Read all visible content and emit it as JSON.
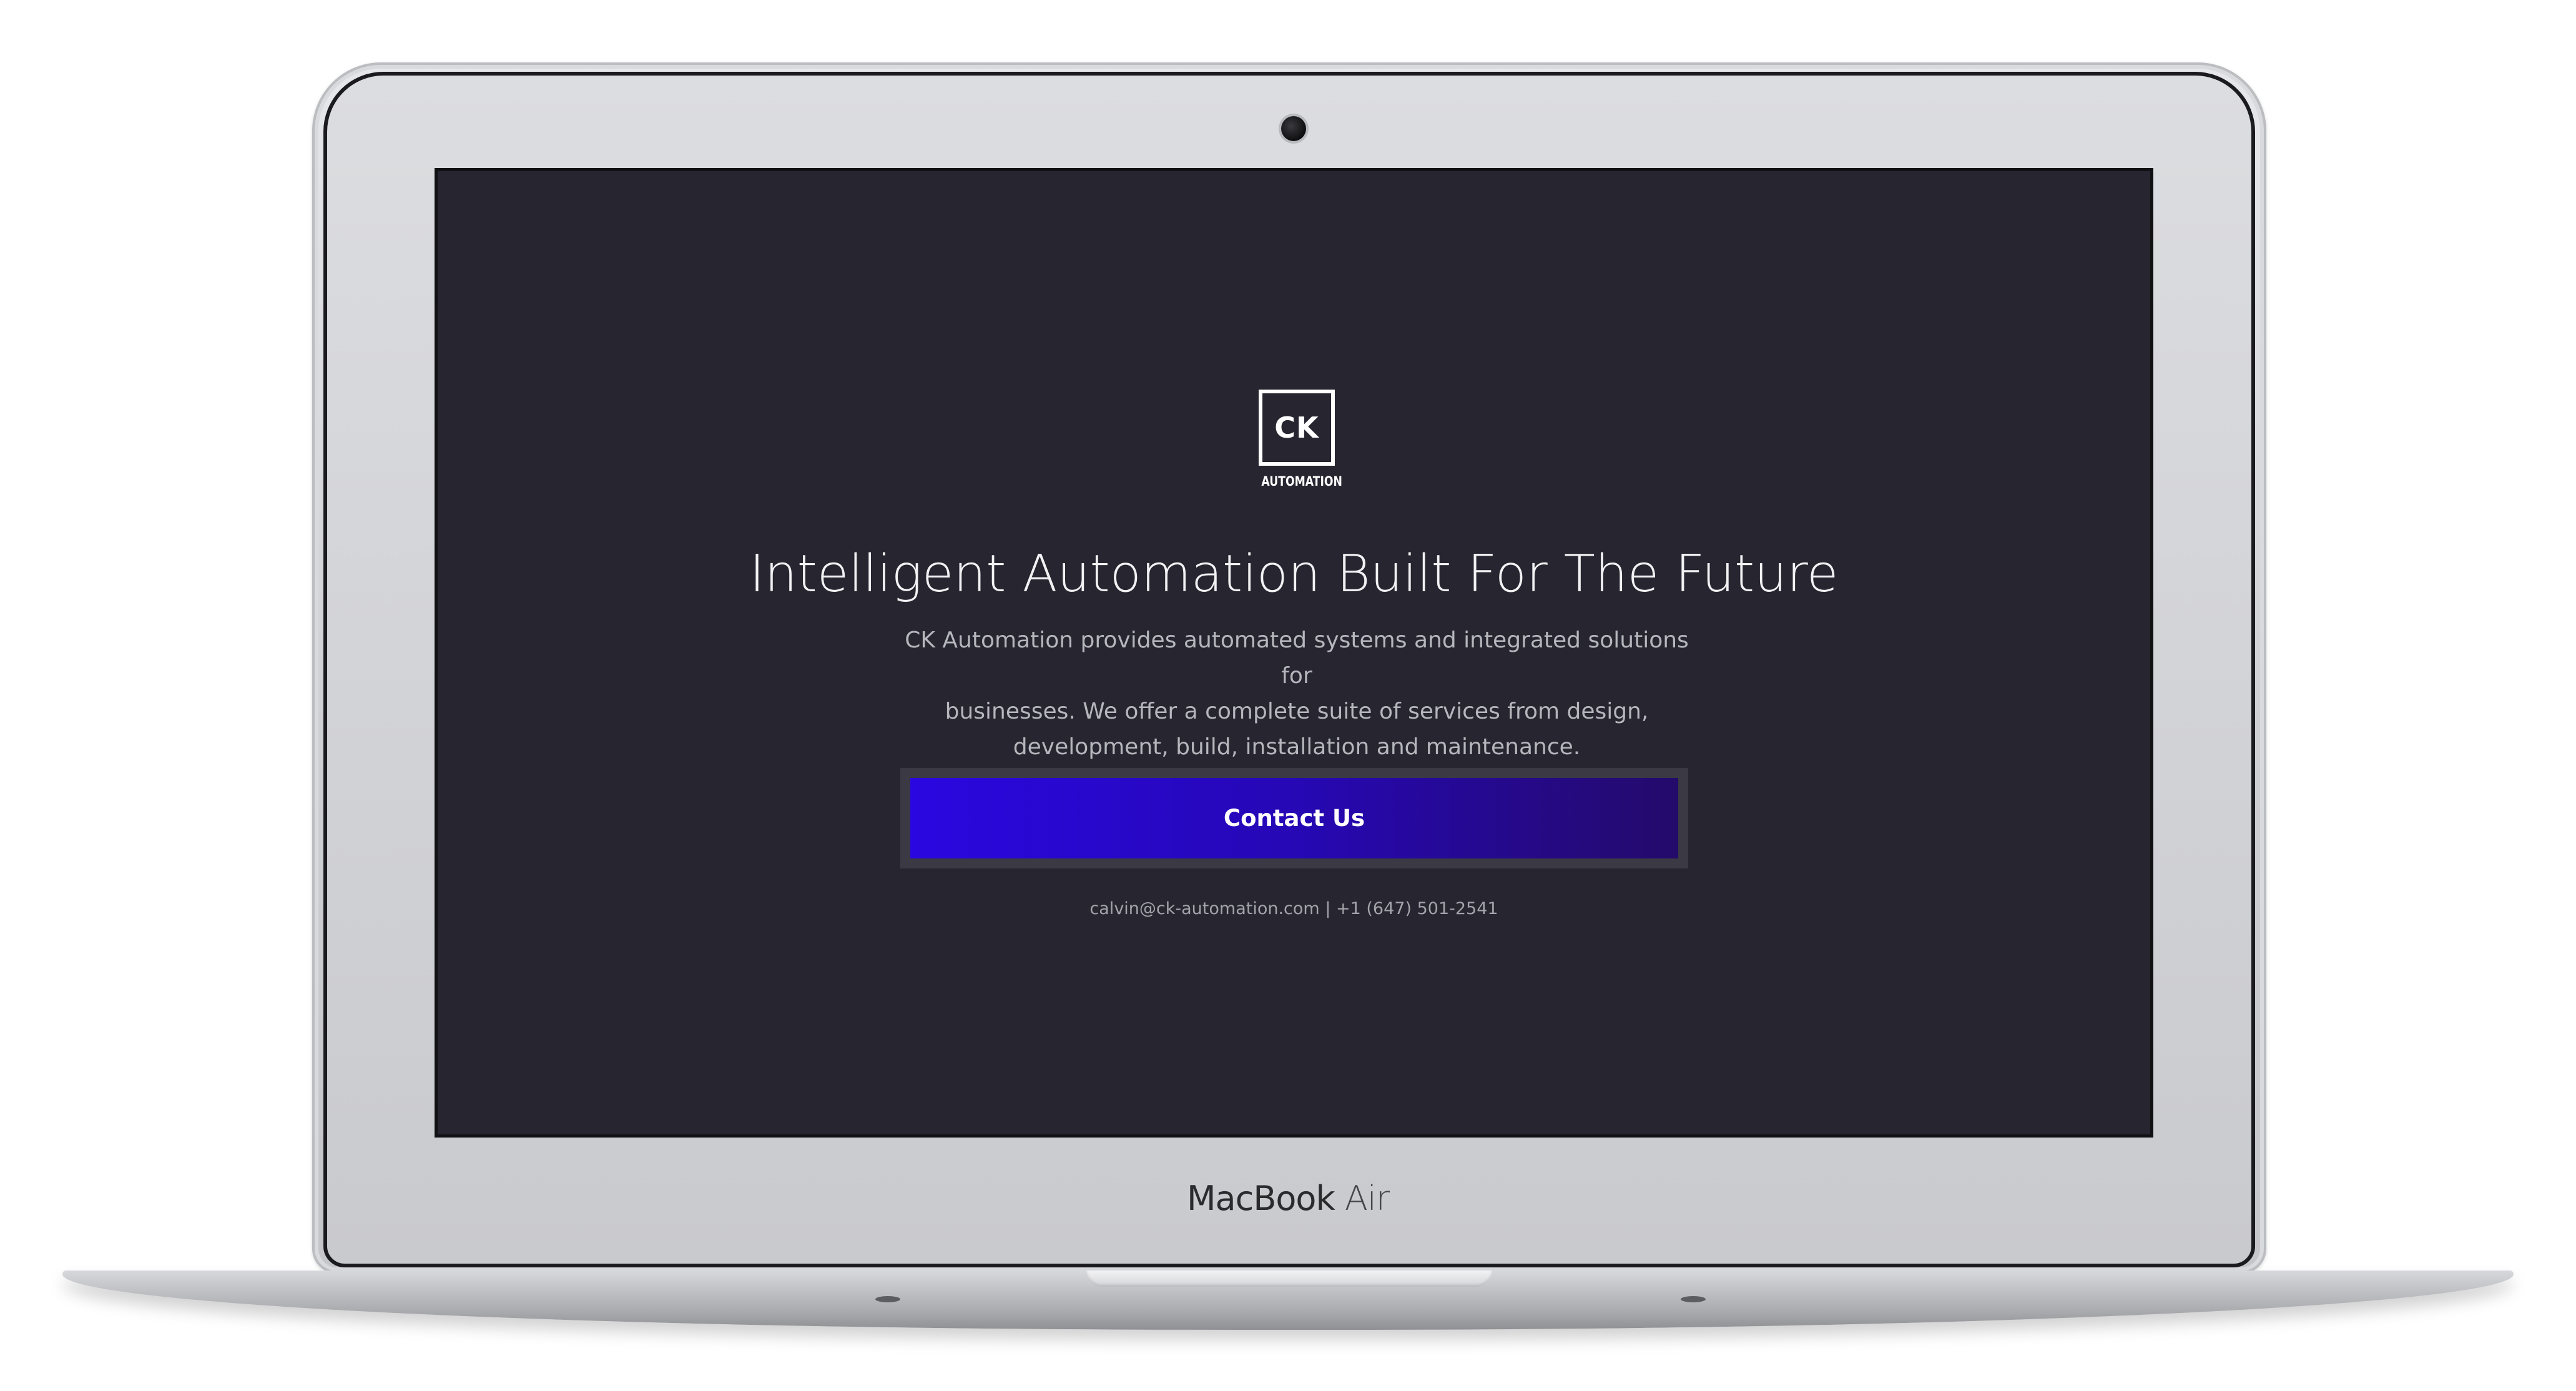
{
  "device": {
    "brand_label": "MacBook",
    "model_label": "Air"
  },
  "page": {
    "logo": {
      "initials": "CK",
      "subtitle": "AUTOMATION"
    },
    "headline": "Intelligent Automation Built For The Future",
    "description_lines": [
      "CK Automation provides automated systems and integrated solutions for",
      "businesses. We offer a complete suite of services from design,",
      "development, build, installation and maintenance."
    ],
    "cta": {
      "label": "Contact Us"
    },
    "contact": {
      "email": "calvin@ck-automation.com",
      "separator": "|",
      "phone": "+1 (647) 501-2541"
    }
  },
  "colors": {
    "screen_background": "#262530",
    "cta_gradient_start": "#2a07e0",
    "cta_gradient_end": "#240a6a",
    "text_primary": "#f2f2f4",
    "text_secondary": "#b6b6bd"
  }
}
